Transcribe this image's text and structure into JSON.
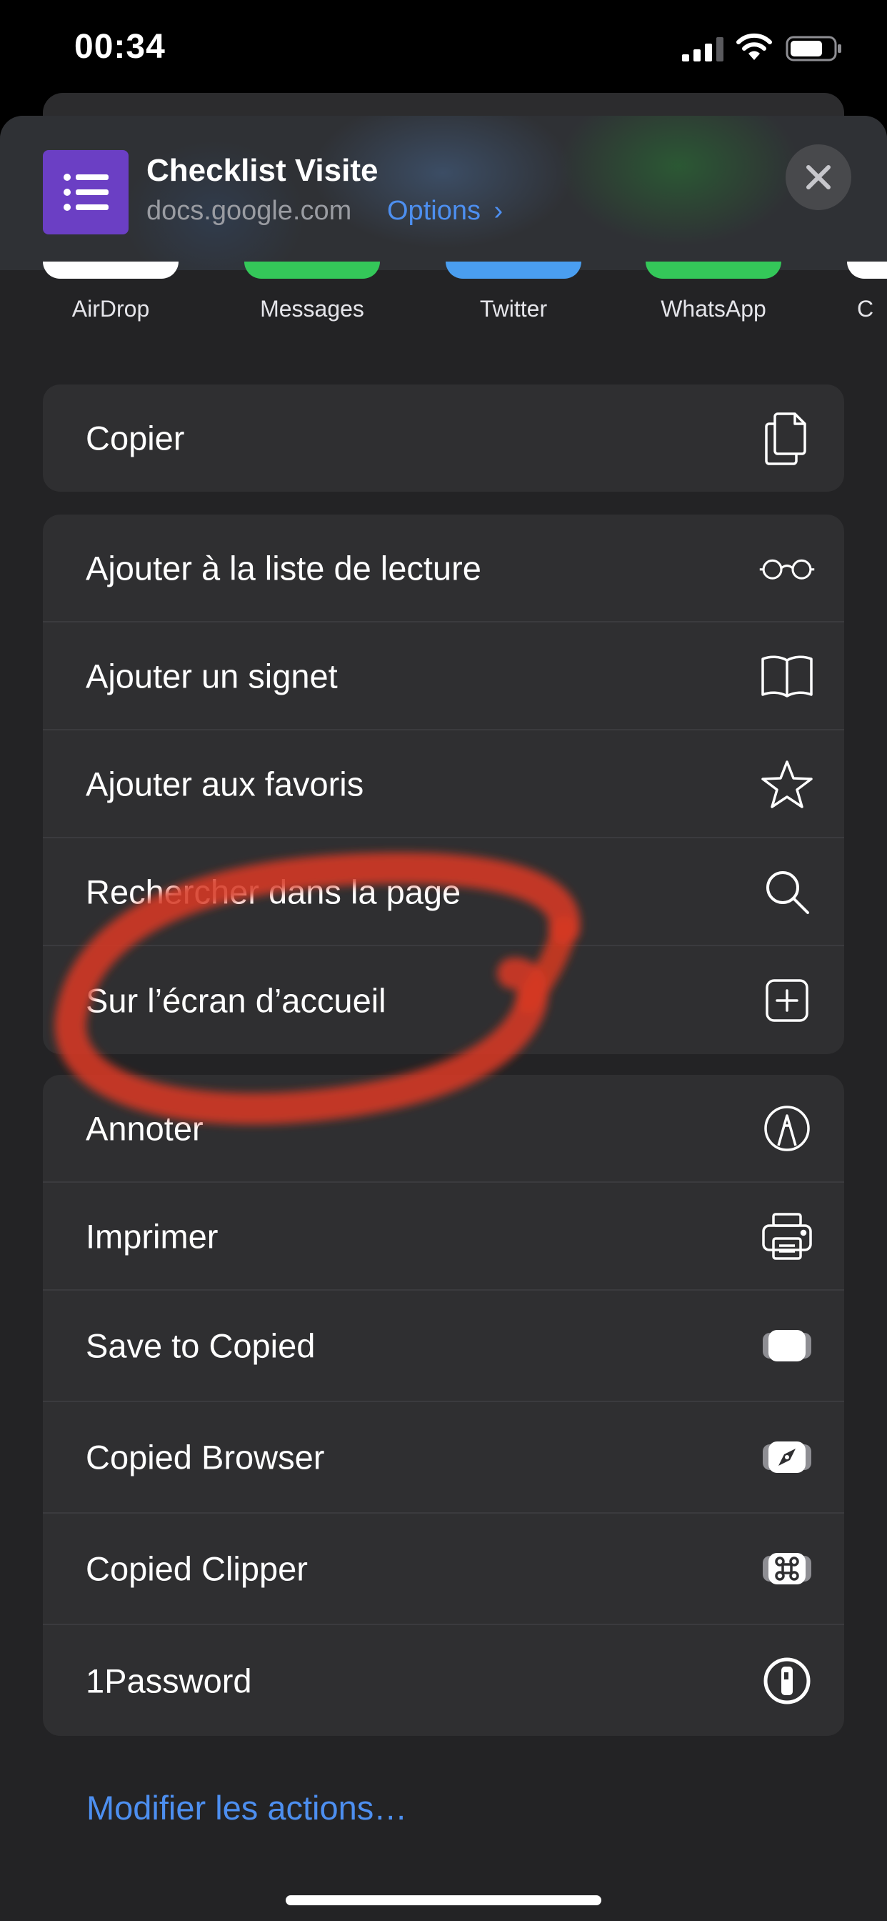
{
  "status_bar": {
    "time": "00:34"
  },
  "header": {
    "title": "Checklist Visite",
    "url": "docs.google.com",
    "options_label": "Options",
    "options_chevron": "›"
  },
  "apps": [
    {
      "label": "AirDrop",
      "color": "#ffffff"
    },
    {
      "label": "Messages",
      "color": "#34c759"
    },
    {
      "label": "Twitter",
      "color": "#4a9ef0"
    },
    {
      "label": "WhatsApp",
      "color": "#34c759"
    },
    {
      "label": "C",
      "color": "#ffffff"
    }
  ],
  "groups": [
    {
      "rows": [
        {
          "label": "Copier",
          "icon": "copy-icon"
        }
      ]
    },
    {
      "rows": [
        {
          "label": "Ajouter à la liste de lecture",
          "icon": "glasses-icon"
        },
        {
          "label": "Ajouter un signet",
          "icon": "book-icon"
        },
        {
          "label": "Ajouter aux favoris",
          "icon": "star-icon"
        },
        {
          "label": "Rechercher dans la page",
          "icon": "search-icon"
        },
        {
          "label": "Sur l’écran d’accueil",
          "icon": "add-square-icon"
        }
      ]
    },
    {
      "rows": [
        {
          "label": "Annoter",
          "icon": "markup-icon"
        },
        {
          "label": "Imprimer",
          "icon": "printer-icon"
        },
        {
          "label": "Save to Copied",
          "icon": "copied-save-icon"
        },
        {
          "label": "Copied Browser",
          "icon": "compass-icon"
        },
        {
          "label": "Copied Clipper",
          "icon": "command-icon"
        },
        {
          "label": "1Password",
          "icon": "onepassword-icon"
        }
      ]
    }
  ],
  "modify_actions": "Modifier les actions…",
  "colors": {
    "accent_blue": "#4d8ff0",
    "annotation_red": "#d63a22",
    "doc_purple": "#6b3fc4"
  }
}
